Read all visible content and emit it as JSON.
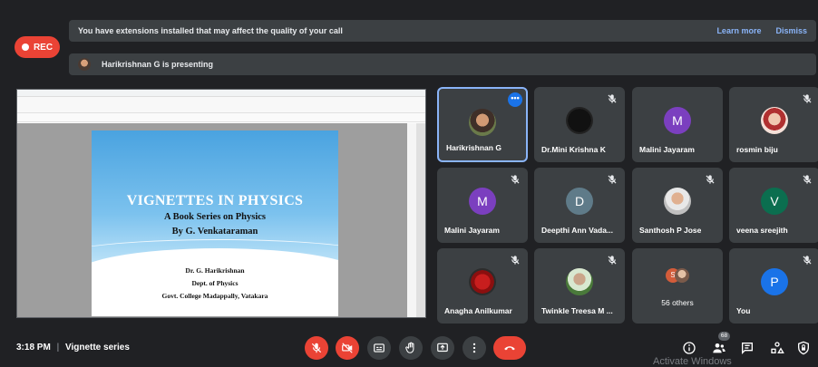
{
  "recording": {
    "label": "REC",
    "color": "#ea4335"
  },
  "banner": {
    "message": "You have extensions installed that may affect the quality of your call",
    "learn_more": "Learn more",
    "dismiss": "Dismiss"
  },
  "presenting": {
    "text": "Harikrishnan G is presenting"
  },
  "shared_screen": {
    "slide": {
      "title": "VIGNETTES IN PHYSICS",
      "subtitle": "A Book Series on Physics",
      "byline": "By G. Venkataraman",
      "author": "Dr. G. Harikrishnan",
      "dept": "Dept. of Physics",
      "college": "Govt. College Madappally, Vatakara"
    }
  },
  "participants": [
    {
      "name": "Harikrishnan G",
      "avatar_type": "photo",
      "active": true,
      "more_label": "•••"
    },
    {
      "name": "Dr.Mini Krishna K",
      "avatar_type": "photo",
      "muted": true
    },
    {
      "name": "Malini Jayaram",
      "avatar_type": "letter",
      "letter": "M",
      "color": "#7b3fbf"
    },
    {
      "name": "rosmin biju",
      "avatar_type": "photo",
      "muted": true
    },
    {
      "name": "Malini Jayaram",
      "avatar_type": "letter",
      "letter": "M",
      "color": "#7b3fbf",
      "muted": true
    },
    {
      "name": "Deepthi Ann Vada...",
      "avatar_type": "letter",
      "letter": "D",
      "color": "#5f7b89",
      "muted": true
    },
    {
      "name": "Santhosh P Jose",
      "avatar_type": "photo",
      "muted": true
    },
    {
      "name": "veena sreejith",
      "avatar_type": "letter",
      "letter": "V",
      "color": "#0b6e4f",
      "muted": true
    },
    {
      "name": "Anagha Anilkumar",
      "avatar_type": "photo",
      "muted": true
    },
    {
      "name": "Twinkle Treesa M ...",
      "avatar_type": "photo",
      "muted": true
    },
    {
      "name": "56 others",
      "avatar_type": "group",
      "group_letter": "S"
    },
    {
      "name": "You",
      "avatar_type": "letter",
      "letter": "P",
      "color": "#1a73e8",
      "muted": true
    }
  ],
  "bottom_bar": {
    "time": "3:18 PM",
    "separator": "|",
    "meeting_name": "Vignette series",
    "people_count": "68",
    "watermark": "Activate Windows"
  }
}
